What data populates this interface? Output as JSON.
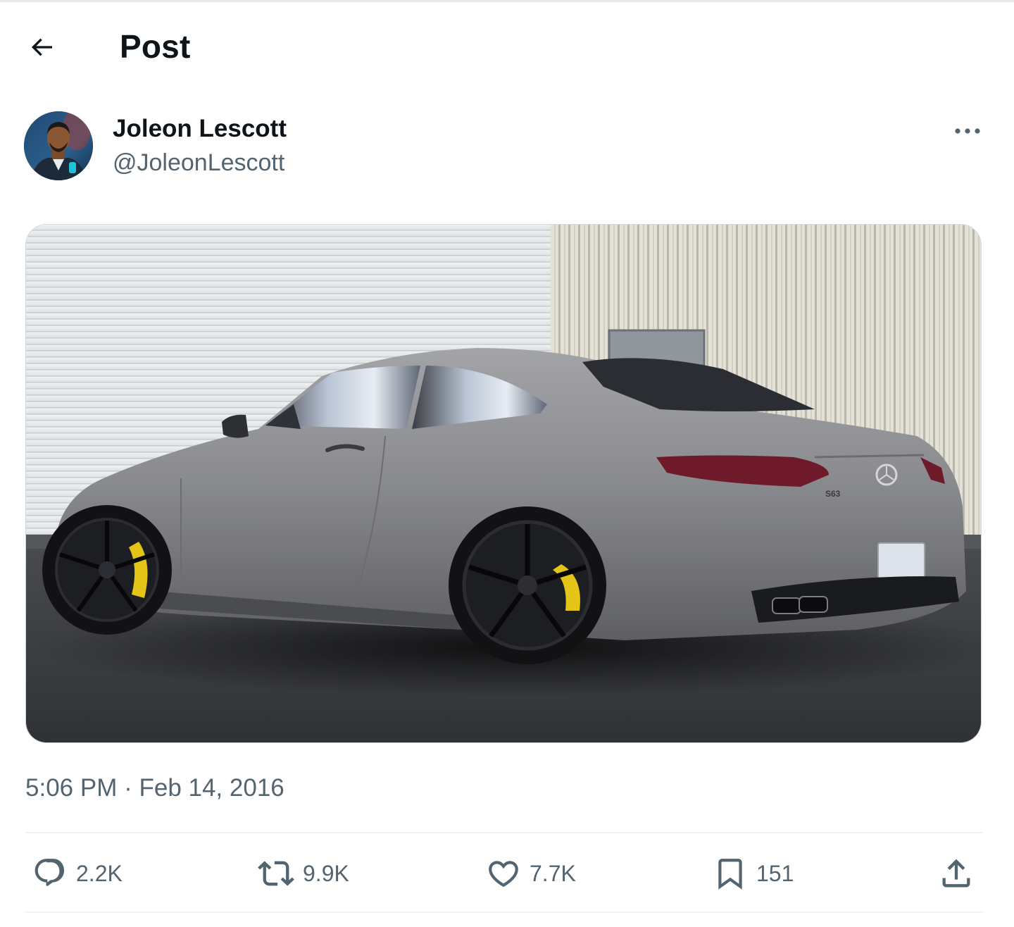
{
  "header": {
    "title": "Post"
  },
  "post": {
    "author": {
      "display_name": "Joleon Lescott",
      "handle": "@JoleonLescott"
    },
    "timestamp": {
      "time": "5:06 PM",
      "separator": " · ",
      "date": "Feb 14, 2016"
    },
    "media": {
      "subject": "matte grey Mercedes S63 AMG coupe with black wheels and yellow brake calipers",
      "badge_text": "S63"
    },
    "stats": {
      "replies": "2.2K",
      "reposts": "9.9K",
      "likes": "7.7K",
      "bookmarks": "151"
    }
  },
  "icons": {
    "back": "arrow-left-icon",
    "more": "more-horizontal-icon",
    "reply": "speech-bubble-icon",
    "repost": "repost-arrows-icon",
    "like": "heart-icon",
    "bookmark": "bookmark-icon",
    "share": "share-upload-icon"
  },
  "colors": {
    "text_primary": "#0f1419",
    "text_secondary": "#536471",
    "divider": "#eff3f4",
    "caliper_yellow": "#e3c417",
    "car_body": "#8a8b8f"
  }
}
